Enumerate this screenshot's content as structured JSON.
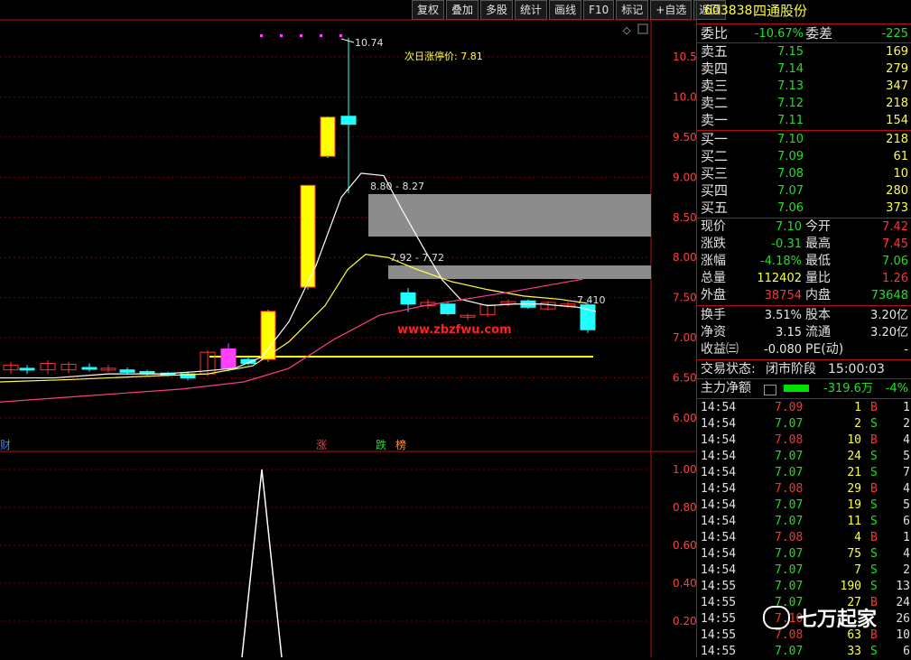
{
  "toolbar": {
    "buttons": [
      "复权",
      "叠加",
      "多股",
      "统计",
      "画线",
      "F10",
      "标记",
      "+自选",
      "返回"
    ]
  },
  "chart": {
    "price_axis": [
      "10.50",
      "10.00",
      "9.50",
      "9.00",
      "8.50",
      "8.00",
      "7.50",
      "7.00",
      "6.50",
      "6.00"
    ],
    "ind_axis": [
      "1.00",
      "0.80",
      "0.60",
      "0.40",
      "0.20"
    ],
    "peak_label": "10.74",
    "next_limit": "次日涨停价: 7.81",
    "gap1": "8.80 - 8.27",
    "gap2": "7.92 - 7.72",
    "last_label": "7.410",
    "watermark": "www.zbzfwu.com",
    "markers": [
      "财",
      "涨",
      "跌",
      "榜"
    ]
  },
  "quote": {
    "code": "603838",
    "name": "四通股份",
    "weibi_label": "委比",
    "weibi": "-10.67%",
    "weicha_label": "委差",
    "weicha": "-225",
    "asks": [
      {
        "label": "卖五",
        "price": "7.15",
        "vol": "169"
      },
      {
        "label": "卖四",
        "price": "7.14",
        "vol": "279"
      },
      {
        "label": "卖三",
        "price": "7.13",
        "vol": "347"
      },
      {
        "label": "卖二",
        "price": "7.12",
        "vol": "218"
      },
      {
        "label": "卖一",
        "price": "7.11",
        "vol": "154"
      }
    ],
    "bids": [
      {
        "label": "买一",
        "price": "7.10",
        "vol": "218"
      },
      {
        "label": "买二",
        "price": "7.09",
        "vol": "61"
      },
      {
        "label": "买三",
        "price": "7.08",
        "vol": "10"
      },
      {
        "label": "买四",
        "price": "7.07",
        "vol": "280"
      },
      {
        "label": "买五",
        "price": "7.06",
        "vol": "373"
      }
    ],
    "stats1": [
      {
        "l1": "现价",
        "v1": "7.10",
        "c1": "green",
        "l2": "今开",
        "v2": "7.42",
        "c2": "red"
      },
      {
        "l1": "涨跌",
        "v1": "-0.31",
        "c1": "green",
        "l2": "最高",
        "v2": "7.45",
        "c2": "red"
      },
      {
        "l1": "涨幅",
        "v1": "-4.18%",
        "c1": "green",
        "l2": "最低",
        "v2": "7.06",
        "c2": "green"
      },
      {
        "l1": "总量",
        "v1": "112402",
        "c1": "yellow",
        "l2": "量比",
        "v2": "1.26",
        "c2": "red"
      },
      {
        "l1": "外盘",
        "v1": "38754",
        "c1": "red",
        "l2": "内盘",
        "v2": "73648",
        "c2": "green"
      }
    ],
    "stats2": [
      {
        "l1": "换手",
        "v1": "3.51%",
        "c1": "white",
        "l2": "股本",
        "v2": "3.20亿",
        "c2": "white"
      },
      {
        "l1": "净资",
        "v1": "3.15",
        "c1": "white",
        "l2": "流通",
        "v2": "3.20亿",
        "c2": "white"
      },
      {
        "l1": "收益㈢",
        "v1": "-0.080",
        "c1": "white",
        "l2": "PE(动)",
        "v2": "-",
        "c2": "white"
      }
    ],
    "status_label": "交易状态:",
    "status": "闭市阶段",
    "status_time": "15:00:03",
    "netflow_label": "主力净额",
    "netflow": "-319.6万",
    "netflow_pct": "-4%",
    "trades": [
      {
        "t": "14:54",
        "p": "7.09",
        "v": "1",
        "s": "B",
        "n": "1"
      },
      {
        "t": "14:54",
        "p": "7.07",
        "v": "2",
        "s": "S",
        "n": "2"
      },
      {
        "t": "14:54",
        "p": "7.08",
        "v": "10",
        "s": "B",
        "n": "4"
      },
      {
        "t": "14:54",
        "p": "7.07",
        "v": "24",
        "s": "S",
        "n": "5"
      },
      {
        "t": "14:54",
        "p": "7.07",
        "v": "21",
        "s": "S",
        "n": "7"
      },
      {
        "t": "14:54",
        "p": "7.08",
        "v": "29",
        "s": "B",
        "n": "4"
      },
      {
        "t": "14:54",
        "p": "7.07",
        "v": "19",
        "s": "S",
        "n": "5"
      },
      {
        "t": "14:54",
        "p": "7.07",
        "v": "11",
        "s": "S",
        "n": "6"
      },
      {
        "t": "14:54",
        "p": "7.08",
        "v": "4",
        "s": "B",
        "n": "1"
      },
      {
        "t": "14:54",
        "p": "7.07",
        "v": "75",
        "s": "S",
        "n": "4"
      },
      {
        "t": "14:54",
        "p": "7.07",
        "v": "7",
        "s": "S",
        "n": "2"
      },
      {
        "t": "14:55",
        "p": "7.07",
        "v": "190",
        "s": "S",
        "n": "13"
      },
      {
        "t": "14:55",
        "p": "7.07",
        "v": "27",
        "s": "B",
        "n": "24"
      },
      {
        "t": "14:55",
        "p": "7.10",
        "v": "",
        "s": "",
        "n": "26"
      },
      {
        "t": "14:55",
        "p": "7.08",
        "v": "63",
        "s": "B",
        "n": "10"
      },
      {
        "t": "14:55",
        "p": "7.07",
        "v": "33",
        "s": "S",
        "n": "6"
      }
    ],
    "watermark_text": "七万起家"
  },
  "colors": {
    "up": "#ff3232",
    "down": "#20ffff",
    "limit": "#ffff00",
    "ma1": "#ffffff",
    "ma2": "#ffff40",
    "ma3": "#ff3c8c",
    "bg": "#000000"
  }
}
